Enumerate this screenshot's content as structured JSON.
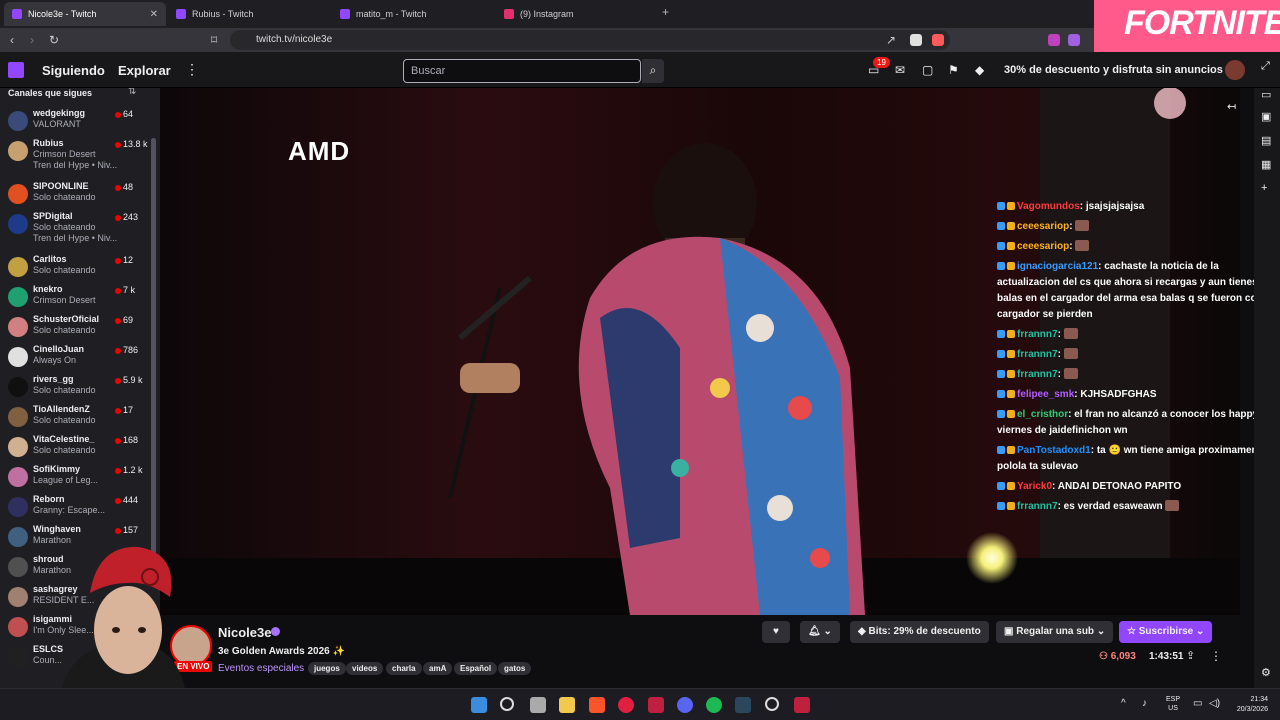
{
  "browser": {
    "tabs": [
      {
        "title": "Nicole3e - Twitch",
        "active": true
      },
      {
        "title": "Rubius - Twitch",
        "active": false
      },
      {
        "title": "matito_m - Twitch",
        "active": false
      },
      {
        "title": "(9) Instagram",
        "active": false
      }
    ],
    "url": "twitch.tv/nicole3e",
    "promo_banner": "FORTNITE"
  },
  "twitch_nav": {
    "following": "Siguiendo",
    "browse": "Explorar",
    "search_placeholder": "Buscar",
    "notifications_count": "19",
    "turbo_promo": "30% de descuento y disfruta sin anuncios"
  },
  "sidebar": {
    "title": "Canales que sigues",
    "channels": [
      {
        "name": "wedgekingg",
        "game": "VALORANT",
        "extra": "",
        "viewers": "64",
        "color": "#3a4a7a"
      },
      {
        "name": "Rubius",
        "game": "Crimson Desert",
        "extra": "Tren del Hype • Niv...",
        "viewers": "13.8 k",
        "color": "#c8a070"
      },
      {
        "name": "SIPOONLINE",
        "game": "Solo chateando",
        "extra": "",
        "viewers": "48",
        "color": "#e05020"
      },
      {
        "name": "SPDigital",
        "game": "Solo chateando",
        "extra": "Tren del Hype • Niv...",
        "viewers": "243",
        "color": "#203a8a"
      },
      {
        "name": "Carlitos",
        "game": "Solo chateando",
        "extra": "",
        "viewers": "12",
        "color": "#c0a040"
      },
      {
        "name": "knekro",
        "game": "Crimson Desert",
        "extra": "",
        "viewers": "7 k",
        "color": "#20a070"
      },
      {
        "name": "SchusterOficial",
        "game": "Solo chateando",
        "extra": "",
        "viewers": "69",
        "color": "#d08080"
      },
      {
        "name": "CinelloJuan",
        "game": "Always On",
        "extra": "",
        "viewers": "786",
        "color": "#e0e0e0"
      },
      {
        "name": "rivers_gg",
        "game": "Solo chateando",
        "extra": "",
        "viewers": "5.9 k",
        "color": "#101010"
      },
      {
        "name": "TioAllendenZ",
        "game": "Solo chateando",
        "extra": "",
        "viewers": "17",
        "color": "#806040"
      },
      {
        "name": "VitaCelestine_",
        "game": "Solo chateando",
        "extra": "",
        "viewers": "168",
        "color": "#d0b090"
      },
      {
        "name": "SofiKimmy",
        "game": "League of Leg...",
        "extra": "",
        "viewers": "1.2 k",
        "color": "#c070a0"
      },
      {
        "name": "Reborn",
        "game": "Granny: Escape...",
        "extra": "",
        "viewers": "444",
        "color": "#303060"
      },
      {
        "name": "Winghaven",
        "game": "Marathon",
        "extra": "",
        "viewers": "157",
        "color": "#406080"
      },
      {
        "name": "shroud",
        "game": "Marathon",
        "extra": "",
        "viewers": "",
        "color": "#505050"
      },
      {
        "name": "sashagrey",
        "game": "RESIDENT E...",
        "extra": "",
        "viewers": "",
        "color": "#a08070"
      },
      {
        "name": "isigammi",
        "game": "I'm Only Slee...",
        "extra": "",
        "viewers": "",
        "color": "#c05050"
      },
      {
        "name": "ESLCS",
        "game": "Coun...",
        "extra": "",
        "viewers": "",
        "color": "#202020"
      }
    ]
  },
  "video": {
    "sponsor_logo": "AMD"
  },
  "chat": [
    {
      "user": "Vagomundos",
      "color": "#ff3a3a",
      "text": ": jsajsjajsajsa",
      "emote": false
    },
    {
      "user": "ceeesariop",
      "color": "#ffb31a",
      "text": ":",
      "emote": true
    },
    {
      "user": "ceeesariop",
      "color": "#ffb31a",
      "text": ":",
      "emote": true
    },
    {
      "user": "ignaciogarcia121",
      "color": "#3a9bff",
      "text": ": cachaste la noticia de la actualizacion del cs que ahora si recargas y aun tienes balas en el cargador del arma esa balas q se fueron con el cargador se pierden",
      "emote": false
    },
    {
      "user": "frrannn7",
      "color": "#20c0a0",
      "text": ":",
      "emote": true
    },
    {
      "user": "frrannn7",
      "color": "#20c0a0",
      "text": ":",
      "emote": true
    },
    {
      "user": "frrannn7",
      "color": "#20c0a0",
      "text": ":",
      "emote": true
    },
    {
      "user": "felipee_smk",
      "color": "#b05cff",
      "text": ": KJHSADFGHAS",
      "emote": false
    },
    {
      "user": "el_cristhor",
      "color": "#2ecc71",
      "text": ": el fran no alcanzó a conocer los happy viernes de jaidefinichon wn",
      "emote": false
    },
    {
      "user": "PanTostadoxd1",
      "color": "#1e90ff",
      "text": ": ta 🙂 wn tiene amiga proximamente polola ta sulevao",
      "emote": false
    },
    {
      "user": "Yarick0",
      "color": "#ff3a3a",
      "text": ": ANDAI DETONAO PAPITO",
      "emote": false
    },
    {
      "user": "frrannn7",
      "color": "#20c0a0",
      "text": ": es verdad esaweawn",
      "emote": true
    }
  ],
  "stream_info": {
    "channel": "Nicole3e",
    "live_badge": "EN VIVO",
    "title": "3e Golden Awards 2026 ✨",
    "category": "Eventos especiales",
    "tags": [
      "juegos",
      "videos",
      "charla",
      "amA",
      "Español",
      "gatos"
    ],
    "bits_label": "Bits: 29% de descuento",
    "gift_label": "Regalar una sub",
    "subscribe_label": "Suscribirse",
    "viewers": "6,093",
    "uptime": "1:43:51"
  },
  "taskbar": {
    "lang_top": "ESP",
    "lang_bottom": "US",
    "time": "21:34",
    "date": "20/3/2026"
  }
}
